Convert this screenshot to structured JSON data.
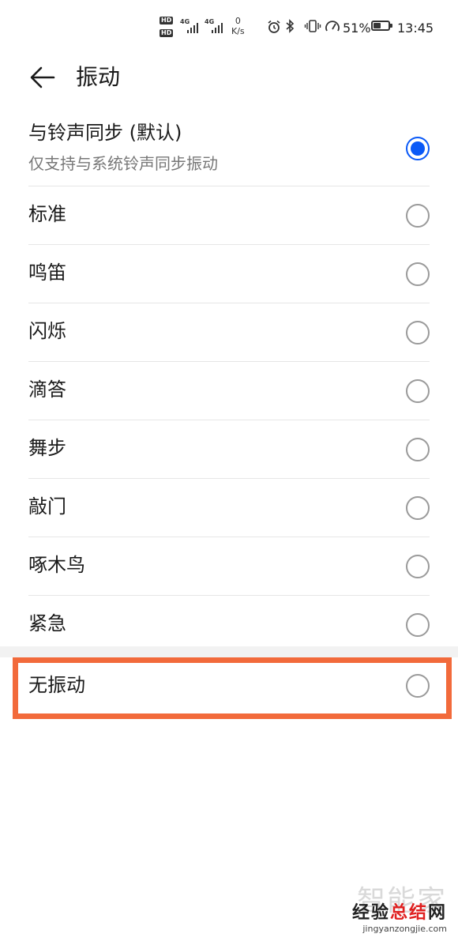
{
  "status_bar": {
    "hd1": "HD",
    "hd2": "HD",
    "net1": "4G",
    "net2": "4G",
    "speed_value": "0",
    "speed_unit": "K/s",
    "battery_percent": "51%",
    "battery_level": 0.51,
    "time": "13:45"
  },
  "header": {
    "title": "振动"
  },
  "options": [
    {
      "label": "与铃声同步 (默认)",
      "sublabel": "仅支持与系统铃声同步振动",
      "selected": true
    },
    {
      "label": "标准",
      "selected": false
    },
    {
      "label": "鸣笛",
      "selected": false
    },
    {
      "label": "闪烁",
      "selected": false
    },
    {
      "label": "滴答",
      "selected": false
    },
    {
      "label": "舞步",
      "selected": false
    },
    {
      "label": "敲门",
      "selected": false
    },
    {
      "label": "啄木鸟",
      "selected": false
    },
    {
      "label": "紧急",
      "selected": false
    }
  ],
  "no_vibration": {
    "label": "无振动",
    "selected": false
  },
  "watermark": {
    "top": "智能家",
    "mid_black": "经验",
    "mid_red": "总结",
    "mid_tail": "网",
    "url": "jingyanzongjie.com"
  },
  "colors": {
    "accent": "#0a59f7",
    "highlight": "#f26a3b"
  }
}
